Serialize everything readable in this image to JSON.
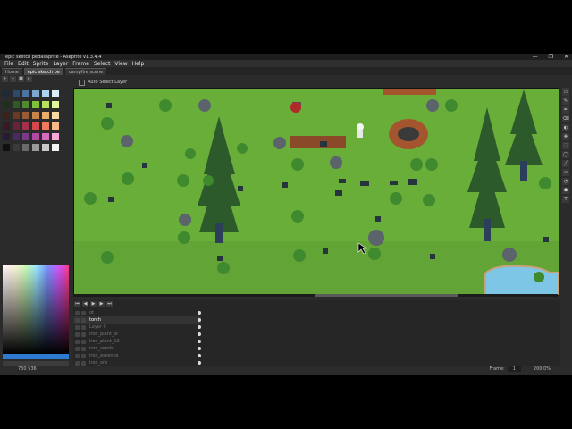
{
  "window": {
    "title": "epic sketch pedasaprite - Aseprite v1.3.4.4",
    "controls": [
      "—",
      "❐",
      "✕"
    ]
  },
  "menu": [
    "File",
    "Edit",
    "Sprite",
    "Layer",
    "Frame",
    "Select",
    "View",
    "Help"
  ],
  "tabs": [
    {
      "label": "Home"
    },
    {
      "label": "epic sketch pe"
    },
    {
      "label": "campfire scene"
    }
  ],
  "palette_panel": {
    "tool_icons": [
      "+",
      "−",
      "■",
      "▸"
    ],
    "colors": [
      "#1b2b3b",
      "#2c4a6a",
      "#4a74a4",
      "#7aa6cf",
      "#a9d3ef",
      "#d8eff8",
      "#203018",
      "#2f5a22",
      "#4f8a2e",
      "#7cc03c",
      "#b4e25c",
      "#e2f69a",
      "#3a2218",
      "#6a3a22",
      "#9a5a32",
      "#c88446",
      "#e8b06a",
      "#f8d8a4",
      "#3a1828",
      "#6a2238",
      "#a4304a",
      "#d8484a",
      "#f07a5a",
      "#f8b888",
      "#2a1838",
      "#4a2a62",
      "#7a3a8a",
      "#b04aa4",
      "#d86ac2",
      "#f8a8d8",
      "#101010",
      "#3a3a3a",
      "#6a6a6a",
      "#9a9a9a",
      "#cacaca",
      "#f4f4f4"
    ]
  },
  "context_bar": {
    "auto_select_label": "Auto Select Layer"
  },
  "timeline": {
    "controls": [
      "⏮",
      "◀",
      "▶",
      "▶",
      "⏭"
    ],
    "layers": [
      {
        "name": "ot",
        "selected": false
      },
      {
        "name": "torch",
        "selected": true
      },
      {
        "name": "Layer 9",
        "selected": false
      },
      {
        "name": "iron_plant_st",
        "selected": false
      },
      {
        "name": "iron_plant_13",
        "selected": false
      },
      {
        "name": "iron_seeds",
        "selected": false
      },
      {
        "name": "iron_essence",
        "selected": false
      },
      {
        "name": "iron_ore",
        "selected": false
      }
    ]
  },
  "status": {
    "position": "730 536",
    "frame_label": "Frame:",
    "frame_value": "1",
    "zoom": "200.0%"
  },
  "right_tools": [
    "▭",
    "✎",
    "✒",
    "⌫",
    "◐",
    "✥",
    "⬚",
    "◯",
    "╱",
    "▭",
    "◔",
    "⬟",
    "T"
  ]
}
